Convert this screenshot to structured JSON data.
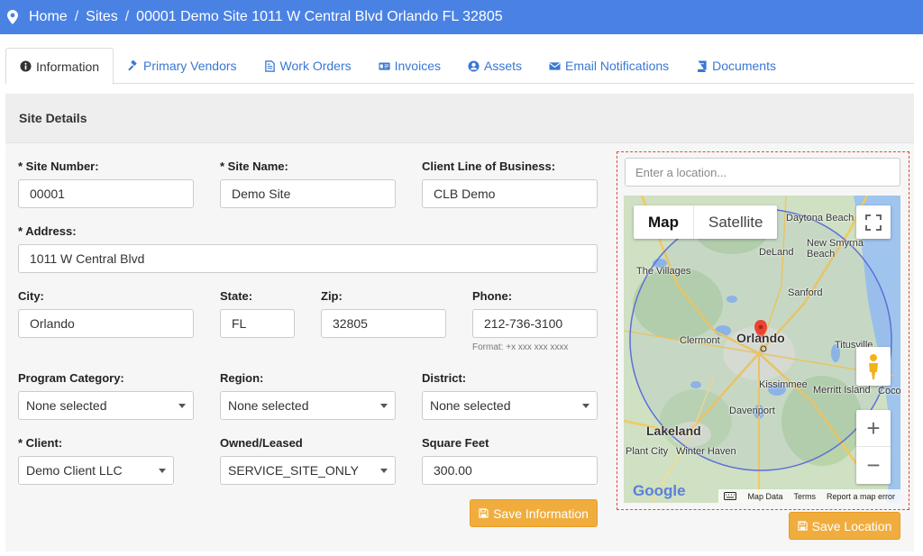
{
  "breadcrumb": {
    "home": "Home",
    "sites": "Sites",
    "current": "00001 Demo Site 1011 W Central Blvd Orlando FL 32805",
    "separator": "/"
  },
  "tabs": [
    {
      "label": "Information",
      "icon": "info-circle-icon",
      "active": true
    },
    {
      "label": "Primary Vendors",
      "icon": "gavel-icon"
    },
    {
      "label": "Work Orders",
      "icon": "file-text-icon"
    },
    {
      "label": "Invoices",
      "icon": "id-card-icon"
    },
    {
      "label": "Assets",
      "icon": "user-circle-icon"
    },
    {
      "label": "Email Notifications",
      "icon": "envelope-icon"
    },
    {
      "label": "Documents",
      "icon": "book-icon"
    }
  ],
  "panel": {
    "title": "Site Details"
  },
  "form": {
    "site_number_label": "* Site Number:",
    "site_number": "00001",
    "site_name_label": "* Site Name:",
    "site_name": "Demo Site",
    "clb_label": "Client Line of Business:",
    "clb": "CLB Demo",
    "address_label": "* Address:",
    "address": "1011 W Central Blvd",
    "city_label": "City:",
    "city": "Orlando",
    "state_label": "State:",
    "state": "FL",
    "zip_label": "Zip:",
    "zip": "32805",
    "phone_label": "Phone:",
    "phone": "212-736-3100",
    "phone_hint": "Format: +x xxx xxx xxxx",
    "program_label": "Program Category:",
    "program": "None selected",
    "region_label": "Region:",
    "region": "None selected",
    "district_label": "District:",
    "district": "None selected",
    "client_label": "* Client:",
    "client": "Demo Client LLC",
    "owned_label": "Owned/Leased",
    "owned": "SERVICE_SITE_ONLY",
    "sqft_label": "Square Feet",
    "sqft": "300.00",
    "save_info": "Save Information"
  },
  "map": {
    "search_placeholder": "Enter a location...",
    "map_type": "Map",
    "satellite_type": "Satellite",
    "zoom_in": "+",
    "zoom_out": "−",
    "footer_data": "Map Data",
    "footer_terms": "Terms",
    "footer_report": "Report a map error",
    "logo": "Google",
    "places": [
      "Daytona Beach",
      "New Smyrna Beach",
      "DeLand",
      "The Villages",
      "Sanford",
      "Orlando",
      "Clermont",
      "Titusville",
      "Kissimmee",
      "Merritt Island",
      "Cocoa",
      "Davenport",
      "Lakeland",
      "Winter Haven",
      "Plant City"
    ],
    "save_location": "Save Location"
  },
  "colors": {
    "topbar": "#4a82e4",
    "link": "#3a77d4",
    "save_button": "#f0ad3e",
    "map_border": "#e34a3b"
  }
}
